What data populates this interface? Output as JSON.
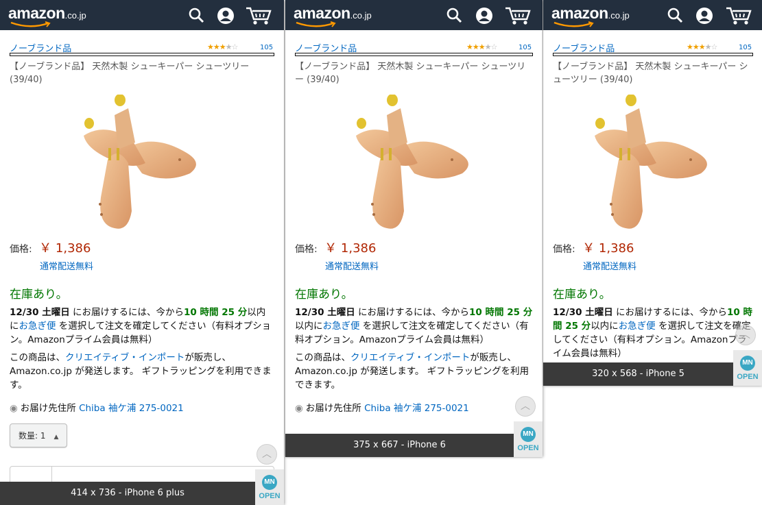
{
  "header": {
    "logo_text": "amazon",
    "logo_tld": ".co.jp"
  },
  "product": {
    "brand": "ノーブランド品",
    "rating_stars": 3.5,
    "review_count": "105",
    "title": "【ノーブランド品】 天然木製 シューキーパー シューツリー (39/40)",
    "price_label": "価格:",
    "price": "￥ 1,386",
    "shipping": "通常配送無料",
    "stock": "在庫あり。",
    "delivery_date": "12/30 土曜日",
    "delivery_text1": " にお届けするには、今から",
    "delivery_time": "10 時間 25 分",
    "delivery_text2": "以内に",
    "express_link": "お急ぎ便",
    "delivery_text3": " を選択して注文を確定してください（有料オプション。Amazonプライム会員は無料）",
    "seller_text1": "この商品は、",
    "seller_link": "クリエイティブ・インポート",
    "seller_text2": "が販売し、Amazon.co.jp が発送します。 ギフトラッピングを利用できます。",
    "address_label": "お届け先住所",
    "address_link": "Chiba 袖ケ浦 275-0021",
    "quantity_label": "数量: 1"
  },
  "devices": [
    {
      "label": "414 x 736 - iPhone 6 plus"
    },
    {
      "label": "375 x 667 - iPhone 6"
    },
    {
      "label": "320 x 568 - iPhone 5"
    }
  ],
  "badge": {
    "mn": "MN",
    "open": "OPEN"
  },
  "colors": {
    "header_bg": "#232f3e",
    "link": "#0066c0",
    "price": "#b12704",
    "in_stock": "#007600",
    "star": "#f0a000"
  }
}
